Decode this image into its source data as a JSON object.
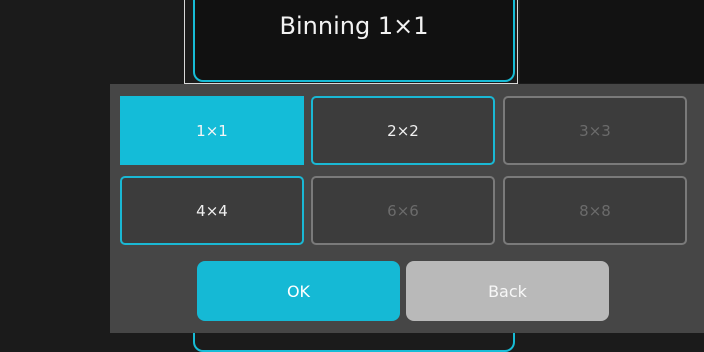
{
  "title": "Binning 1×1",
  "options": [
    {
      "label": "1×1",
      "state": "selected"
    },
    {
      "label": "2×2",
      "state": "enabled"
    },
    {
      "label": "3×3",
      "state": "disabled"
    },
    {
      "label": "4×4",
      "state": "enabled"
    },
    {
      "label": "6×6",
      "state": "disabled"
    },
    {
      "label": "8×8",
      "state": "disabled"
    }
  ],
  "buttons": {
    "ok": "OK",
    "back": "Back"
  },
  "colors": {
    "accent": "#14bcd8",
    "panel": "#464646",
    "back_button": "#b9b9b9",
    "background": "#1b1b1b"
  }
}
